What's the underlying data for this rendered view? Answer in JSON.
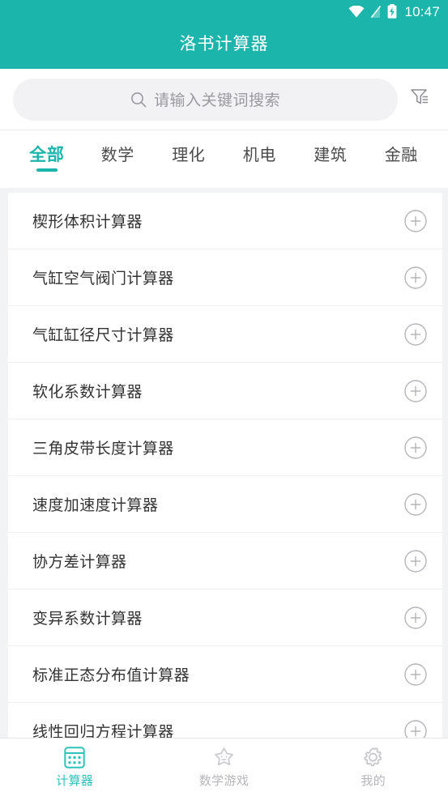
{
  "theme": {
    "accent": "#1bb5ac",
    "nav_active": "#2ec4bc",
    "page_bg": "#f2f3f5",
    "card_bg": "#ffffff"
  },
  "statusbar": {
    "time": "10:47",
    "icons": [
      "wifi-icon",
      "signal-off-icon",
      "battery-charging-icon"
    ]
  },
  "header": {
    "title": "洛书计算器"
  },
  "search": {
    "placeholder": "请输入关键词搜索",
    "icon": "search-icon",
    "filter_icon": "filter-icon"
  },
  "tabs": [
    {
      "label": "全部",
      "active": true
    },
    {
      "label": "数学",
      "active": false
    },
    {
      "label": "理化",
      "active": false
    },
    {
      "label": "机电",
      "active": false
    },
    {
      "label": "建筑",
      "active": false
    },
    {
      "label": "金融",
      "active": false
    }
  ],
  "list": {
    "add_icon": "plus-circle-icon",
    "items": [
      {
        "label": "楔形体积计算器"
      },
      {
        "label": "气缸空气阀门计算器"
      },
      {
        "label": "气缸缸径尺寸计算器"
      },
      {
        "label": "软化系数计算器"
      },
      {
        "label": "三角皮带长度计算器"
      },
      {
        "label": "速度加速度计算器"
      },
      {
        "label": "协方差计算器"
      },
      {
        "label": "变异系数计算器"
      },
      {
        "label": "标准正态分布值计算器"
      },
      {
        "label": "线性回归方程计算器"
      }
    ]
  },
  "bottom_nav": [
    {
      "label": "计算器",
      "icon": "calculator-icon",
      "active": true
    },
    {
      "label": "数学游戏",
      "icon": "star-face-icon",
      "active": false
    },
    {
      "label": "我的",
      "icon": "gear-icon",
      "active": false
    }
  ]
}
